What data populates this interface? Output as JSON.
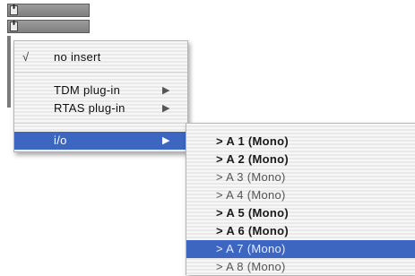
{
  "menu": {
    "no_insert": {
      "label": "no insert",
      "check": "√"
    },
    "items": [
      {
        "label": "TDM plug-in",
        "arrow": "▶"
      },
      {
        "label": "RTAS plug-in",
        "arrow": "▶"
      },
      {
        "label": "i/o",
        "arrow": "▶"
      }
    ]
  },
  "submenu": {
    "items": [
      {
        "label": "> A 1 (Mono)"
      },
      {
        "label": "> A 2 (Mono)"
      },
      {
        "label": "> A 3 (Mono)"
      },
      {
        "label": "> A 4 (Mono)"
      },
      {
        "label": "> A 5 (Mono)"
      },
      {
        "label": "> A 6 (Mono)"
      },
      {
        "label": "> A 7 (Mono)"
      },
      {
        "label": "> A 8 (Mono)"
      }
    ]
  },
  "colors": {
    "highlight": "#3c66c0"
  }
}
